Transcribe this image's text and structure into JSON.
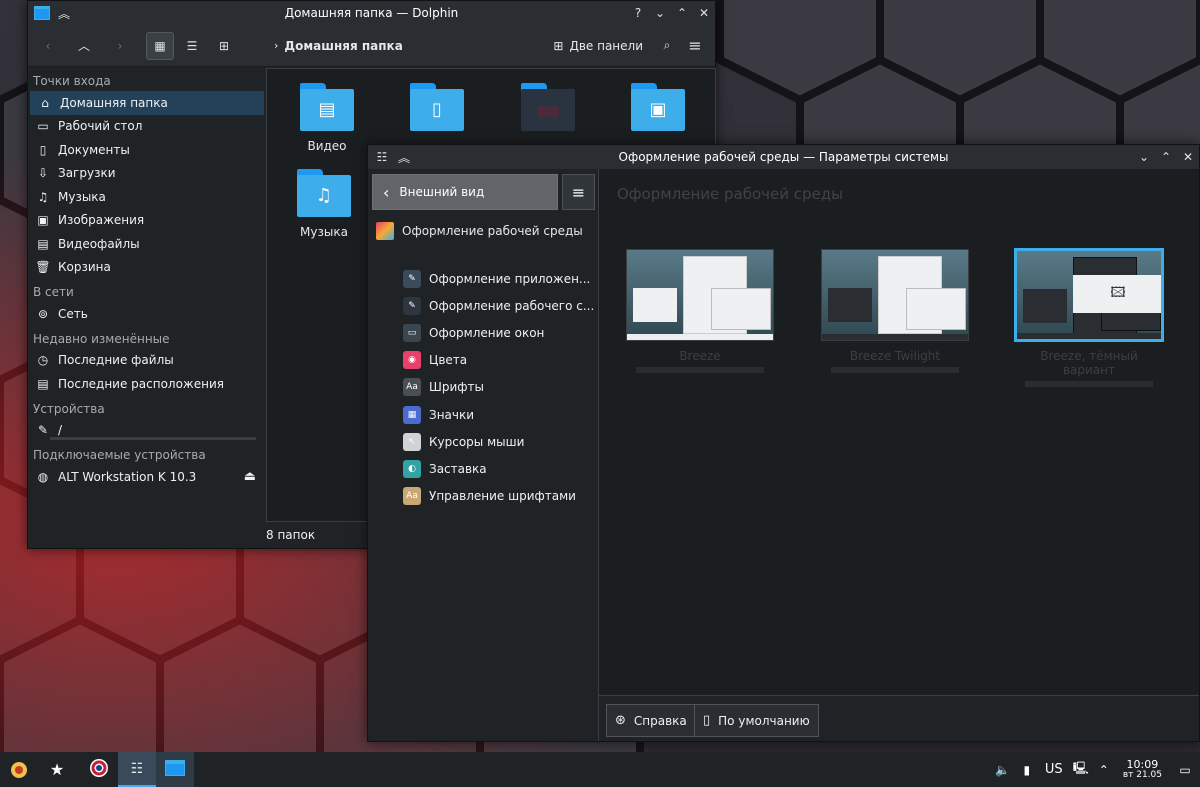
{
  "dolphin": {
    "title": "Домашняя папка — Dolphin",
    "breadcrumb": "Домашняя папка",
    "split_label": "Две панели",
    "status": "8 папок",
    "groups": {
      "entry": "Точки входа",
      "network": "В сети",
      "recent": "Недавно изменённые",
      "devices": "Устройства",
      "removable": "Подключаемые устройства"
    },
    "places": [
      {
        "label": "Домашняя папка",
        "icon": "home-icon"
      },
      {
        "label": "Рабочий стол",
        "icon": "desktop-icon"
      },
      {
        "label": "Документы",
        "icon": "documents-icon"
      },
      {
        "label": "Загрузки",
        "icon": "downloads-icon"
      },
      {
        "label": "Музыка",
        "icon": "music-icon"
      },
      {
        "label": "Изображения",
        "icon": "pictures-icon"
      },
      {
        "label": "Видеофайлы",
        "icon": "videos-icon"
      },
      {
        "label": "Корзина",
        "icon": "trash-icon"
      }
    ],
    "network_items": [
      {
        "label": "Сеть",
        "icon": "network-icon"
      }
    ],
    "recent_items": [
      {
        "label": "Последние файлы",
        "icon": "recent-files-icon"
      },
      {
        "label": "Последние расположения",
        "icon": "recent-locations-icon"
      }
    ],
    "device_items": [
      {
        "label": "/",
        "icon": "drive-icon"
      }
    ],
    "removable_items": [
      {
        "label": "ALT Workstation K 10.3",
        "icon": "disc-icon"
      }
    ],
    "files": [
      {
        "label": "Видео",
        "icon": "video-folder-icon"
      },
      {
        "label": "",
        "icon": "documents-folder-icon"
      },
      {
        "label": "",
        "icon": "desktop-folder-icon"
      },
      {
        "label": "",
        "icon": "pictures-folder-icon"
      },
      {
        "label": "Музыка",
        "icon": "music-folder-icon"
      }
    ]
  },
  "settings": {
    "title": "Оформление рабочей среды — Параметры системы",
    "back_label": "Внешний вид",
    "category": "Оформление рабочей среды",
    "heading": "Оформление рабочей среды",
    "subitems": [
      {
        "label": "Оформление приложен...",
        "color": "#3b4a5a"
      },
      {
        "label": "Оформление рабочего с...",
        "color": "#2c3540"
      },
      {
        "label": "Оформление окон",
        "color": "#3a4650"
      },
      {
        "label": "Цвета",
        "color": "#e8406b"
      },
      {
        "label": "Шрифты",
        "color": "#4a4f55"
      },
      {
        "label": "Значки",
        "color": "#4a6bd0"
      },
      {
        "label": "Курсоры мыши",
        "color": "#d0d2d4"
      },
      {
        "label": "Заставка",
        "color": "#31a3a5"
      },
      {
        "label": "Управление шрифтами",
        "color": "#c9a874"
      }
    ],
    "themes": [
      {
        "name": "Breeze"
      },
      {
        "name": "Breeze Twilight"
      },
      {
        "name": "Breeze, тёмный вариант"
      }
    ],
    "help_label": "Справка",
    "defaults_label": "По умолчанию"
  },
  "panel": {
    "layout": "US",
    "time": "10:09",
    "date": "вт 21.05"
  }
}
